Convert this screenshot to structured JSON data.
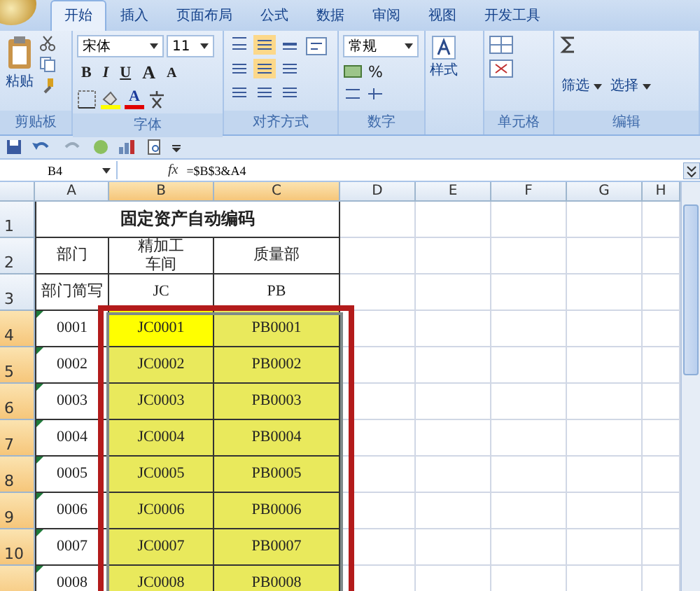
{
  "tabs": [
    {
      "label": "开始",
      "selected": true
    },
    {
      "label": "插入",
      "selected": false
    },
    {
      "label": "页面布局",
      "selected": false
    },
    {
      "label": "公式",
      "selected": false
    },
    {
      "label": "数据",
      "selected": false
    },
    {
      "label": "审阅",
      "selected": false
    },
    {
      "label": "视图",
      "selected": false
    },
    {
      "label": "开发工具",
      "selected": false
    }
  ],
  "ribbon": {
    "groups": [
      {
        "kind": "clipboard",
        "label": "剪贴板",
        "paste": "粘贴"
      },
      {
        "kind": "font",
        "label": "字体",
        "font": "宋体",
        "size": "11",
        "styles": [
          "B",
          "I",
          "U"
        ],
        "grow": "A",
        "shrink": "A",
        "font_color_label": "A"
      },
      {
        "kind": "alignment",
        "label": "对齐方式"
      },
      {
        "kind": "number",
        "label": "数字",
        "format": "常规",
        "percent": "%"
      },
      {
        "kind": "styles",
        "button": "样式"
      },
      {
        "kind": "cells",
        "label": "单元格"
      },
      {
        "kind": "editing",
        "label": "编辑",
        "buttons": [
          "筛选",
          "选择"
        ]
      }
    ]
  },
  "formula_bar": {
    "name_box": "B4",
    "fx": "fx",
    "formula": "=$B$3&A4"
  },
  "sheet": {
    "columns": [
      {
        "label": "A",
        "selected": false
      },
      {
        "label": "B",
        "selected": true
      },
      {
        "label": "C",
        "selected": true
      },
      {
        "label": "D",
        "selected": false
      },
      {
        "label": "E",
        "selected": false
      },
      {
        "label": "F",
        "selected": false
      },
      {
        "label": "G",
        "selected": false
      },
      {
        "label": "H",
        "selected": false
      }
    ],
    "rows": [
      {
        "label": "1",
        "selected": false,
        "cells": [
          {
            "kind": "merged"
          },
          {
            "kind": "title",
            "text": "固定资产自动编码"
          },
          {
            "kind": "merged"
          }
        ]
      },
      {
        "label": "2",
        "selected": false,
        "cells": [
          {
            "kind": "text",
            "text": "部门"
          },
          {
            "kind": "lines",
            "lines": [
              "精加工",
              "车间"
            ]
          },
          {
            "kind": "text",
            "text": "质量部"
          }
        ]
      },
      {
        "label": "3",
        "selected": false,
        "cells": [
          {
            "kind": "text",
            "text": "部门简写"
          },
          {
            "kind": "text",
            "text": "JC"
          },
          {
            "kind": "text",
            "text": "PB"
          }
        ]
      },
      {
        "label": "4",
        "selected": true,
        "cells": [
          {
            "kind": "text",
            "text": "0001",
            "error_mark": true
          },
          {
            "kind": "text",
            "text": "JC0001",
            "active": true
          },
          {
            "kind": "text",
            "text": "PB0001"
          }
        ]
      },
      {
        "label": "5",
        "selected": true,
        "cells": [
          {
            "kind": "text",
            "text": "0002",
            "error_mark": true
          },
          {
            "kind": "text",
            "text": "JC0002"
          },
          {
            "kind": "text",
            "text": "PB0002"
          }
        ]
      },
      {
        "label": "6",
        "selected": true,
        "cells": [
          {
            "kind": "text",
            "text": "0003",
            "error_mark": true
          },
          {
            "kind": "text",
            "text": "JC0003"
          },
          {
            "kind": "text",
            "text": "PB0003"
          }
        ]
      },
      {
        "label": "7",
        "selected": true,
        "cells": [
          {
            "kind": "text",
            "text": "0004",
            "error_mark": true
          },
          {
            "kind": "text",
            "text": "JC0004"
          },
          {
            "kind": "text",
            "text": "PB0004"
          }
        ]
      },
      {
        "label": "8",
        "selected": true,
        "cells": [
          {
            "kind": "text",
            "text": "0005",
            "error_mark": true
          },
          {
            "kind": "text",
            "text": "JC0005"
          },
          {
            "kind": "text",
            "text": "PB0005"
          }
        ]
      },
      {
        "label": "9",
        "selected": true,
        "cells": [
          {
            "kind": "text",
            "text": "0006",
            "error_mark": true
          },
          {
            "kind": "text",
            "text": "JC0006"
          },
          {
            "kind": "text",
            "text": "PB0006"
          }
        ]
      },
      {
        "label": "10",
        "selected": true,
        "cells": [
          {
            "kind": "text",
            "text": "0007",
            "error_mark": true
          },
          {
            "kind": "text",
            "text": "JC0007"
          },
          {
            "kind": "text",
            "text": "PB0007"
          }
        ]
      },
      {
        "selected": true,
        "cells": [
          {
            "kind": "text",
            "text": "0008",
            "error_mark": true
          },
          {
            "kind": "text",
            "text": "JC0008"
          },
          {
            "kind": "text",
            "text": "PB0008"
          }
        ]
      }
    ]
  }
}
